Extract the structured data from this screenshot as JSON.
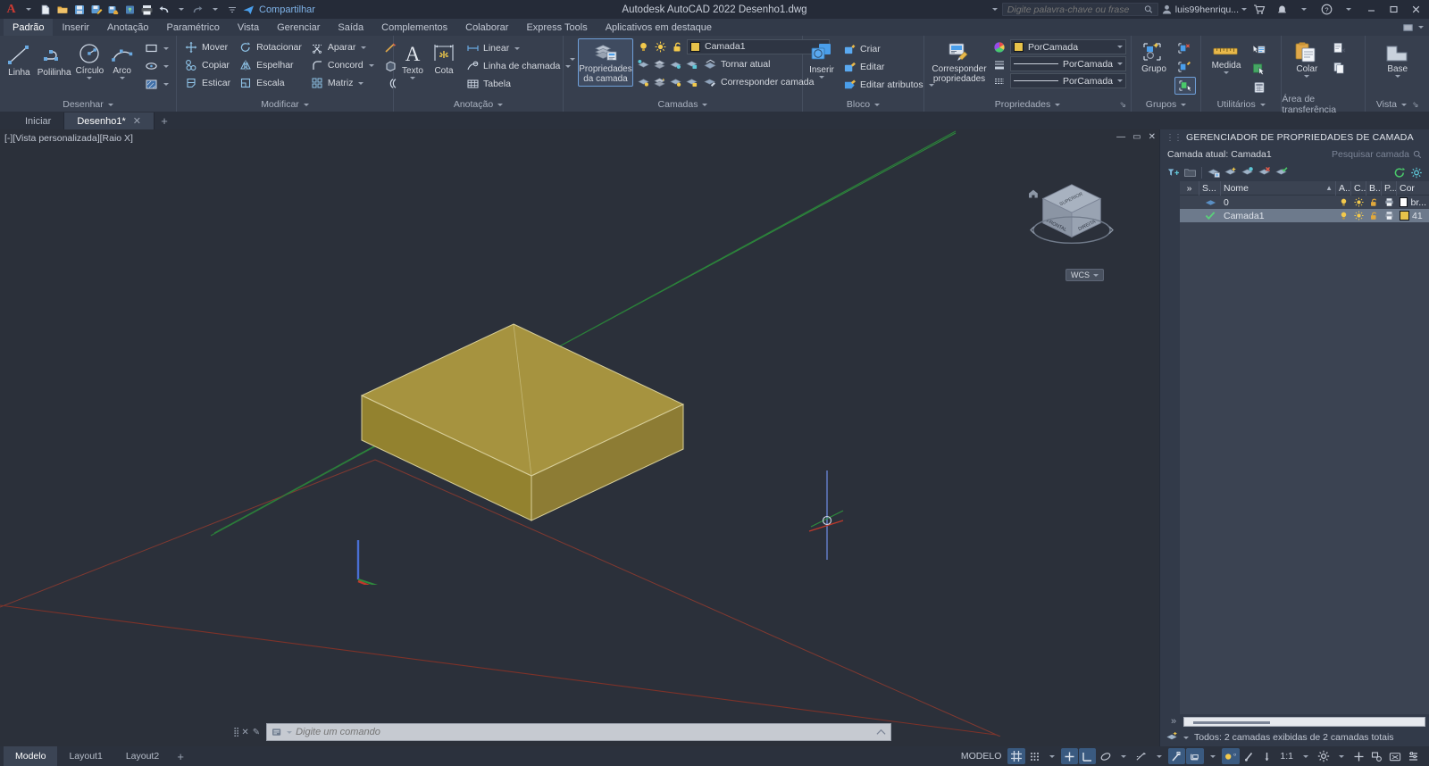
{
  "titlebar": {
    "app_logo": "autocad-a-logo",
    "quick_access": [
      {
        "name": "new-icon",
        "label": "Novo"
      },
      {
        "name": "open-icon",
        "label": "Abrir"
      },
      {
        "name": "save-icon",
        "label": "Salvar"
      },
      {
        "name": "save-as-icon",
        "label": "Salvar como"
      },
      {
        "name": "save-cloud-icon",
        "label": "Salvar no Web e Mobile"
      },
      {
        "name": "open-cloud-icon",
        "label": "Abrir do Web e Mobile"
      },
      {
        "name": "plot-icon",
        "label": "Plotar"
      },
      {
        "name": "undo-icon",
        "label": "Desfazer"
      },
      {
        "name": "redo-icon",
        "label": "Refazer"
      }
    ],
    "share_label": "Compartilhar",
    "title": "Autodesk AutoCAD 2022    Desenho1.dwg",
    "search_placeholder": "Digite palavra-chave ou frase",
    "user": "luis99henriqu...",
    "window_buttons": [
      "minimize",
      "maximize",
      "close"
    ]
  },
  "ribbon_tabs": [
    {
      "label": "Padrão",
      "active": true
    },
    {
      "label": "Inserir",
      "active": false
    },
    {
      "label": "Anotação",
      "active": false
    },
    {
      "label": "Paramétrico",
      "active": false
    },
    {
      "label": "Vista",
      "active": false
    },
    {
      "label": "Gerenciar",
      "active": false
    },
    {
      "label": "Saída",
      "active": false
    },
    {
      "label": "Complementos",
      "active": false
    },
    {
      "label": "Colaborar",
      "active": false
    },
    {
      "label": "Express Tools",
      "active": false
    },
    {
      "label": "Aplicativos em destaque",
      "active": false
    }
  ],
  "panels": {
    "desenhar": {
      "title": "Desenhar",
      "big": [
        {
          "label": "Linha",
          "icon": "line-icon"
        },
        {
          "label": "Polilinha",
          "icon": "polyline-icon"
        },
        {
          "label": "Círculo",
          "icon": "circle-icon",
          "dropdown": true
        },
        {
          "label": "Arco",
          "icon": "arc-icon",
          "dropdown": true
        }
      ],
      "small_icons": [
        {
          "name": "rectangle-icon"
        },
        {
          "name": "ellipse-icon"
        },
        {
          "name": "hatch-icon"
        }
      ]
    },
    "modificar": {
      "title": "Modificar",
      "items": [
        {
          "label": "Mover",
          "icon": "move-icon"
        },
        {
          "label": "Rotacionar",
          "icon": "rotate-icon"
        },
        {
          "label": "Aparar",
          "icon": "trim-icon",
          "dropdown": true
        },
        {
          "label": "Copiar",
          "icon": "copy-icon"
        },
        {
          "label": "Espelhar",
          "icon": "mirror-icon"
        },
        {
          "label": "Concord",
          "icon": "fillet-icon",
          "dropdown": true
        },
        {
          "label": "Esticar",
          "icon": "stretch-icon"
        },
        {
          "label": "Escala",
          "icon": "scale-icon"
        },
        {
          "label": "Matriz",
          "icon": "array-icon",
          "dropdown": true
        }
      ],
      "extra_icons": [
        {
          "name": "explode-icon"
        },
        {
          "name": "solid-edit-icon"
        },
        {
          "name": "offset-icon"
        }
      ]
    },
    "anotacao": {
      "title": "Anotação",
      "big": [
        {
          "label": "Texto",
          "icon": "text-icon",
          "dropdown": true
        },
        {
          "label": "Cota",
          "icon": "dimension-icon"
        }
      ],
      "items": [
        {
          "label": "Linear",
          "icon": "linear-dim-icon",
          "dropdown": true
        },
        {
          "label": "Linha de chamada",
          "icon": "leader-icon",
          "dropdown": true
        },
        {
          "label": "Tabela",
          "icon": "table-icon"
        }
      ]
    },
    "camadas": {
      "title": "Camadas",
      "big": {
        "label_line1": "Propriedades",
        "label_line2": "da camada",
        "icon": "layer-properties-icon",
        "active": true
      },
      "current_layer": "Camada1",
      "layer_color": "#e8c34a",
      "toolbar_icons": [
        "lightbulb-icon",
        "sun-icon",
        "unlock-icon"
      ],
      "items": [
        {
          "label": "Tornar atual",
          "icon": "make-current-icon"
        },
        {
          "label": "Corresponder camada",
          "icon": "match-layer-icon"
        }
      ],
      "row_icons_top": [
        "layer-isolate-icon",
        "layer-freeze-icon",
        "layer-off-icon",
        "layer-lock-icon"
      ],
      "row_icons_bottom": [
        "layer-unisolate-icon",
        "layer-thaw-icon",
        "layer-on-icon",
        "layer-unlock-icon"
      ]
    },
    "bloco": {
      "title": "Bloco",
      "big": {
        "label": "Inserir",
        "icon": "insert-block-icon",
        "dropdown": true
      },
      "items": [
        {
          "label": "Criar",
          "icon": "create-block-icon"
        },
        {
          "label": "Editar",
          "icon": "edit-block-icon"
        },
        {
          "label": "Editar atributos",
          "icon": "edit-attributes-icon",
          "dropdown": true
        }
      ]
    },
    "propriedades": {
      "title": "Propriedades",
      "big": {
        "label_line1": "Corresponder",
        "label_line2": "propriedades",
        "icon": "match-properties-icon"
      },
      "rows": [
        {
          "icon": "color-wheel-icon",
          "value": "PorCamada",
          "swatch": "#e8c34a",
          "type": "color"
        },
        {
          "icon": "lineweight-icon",
          "value": "PorCamada",
          "type": "lineweight"
        },
        {
          "icon": "linetype-icon",
          "value": "PorCamada",
          "type": "linetype"
        }
      ]
    },
    "grupos": {
      "title": "Grupos",
      "big": {
        "label": "Grupo",
        "icon": "group-icon"
      },
      "small_icons": [
        "ungroup-icon",
        "group-edit-icon",
        "group-select-icon"
      ]
    },
    "utilitarios": {
      "title": "Utilitários",
      "big": {
        "label": "Medida",
        "icon": "measure-icon",
        "dropdown": true
      },
      "small_icons": [
        "quick-select-icon",
        "quick-calc-area-icon",
        "calculator-icon"
      ]
    },
    "area_transferencia": {
      "title": "Área de transferência",
      "big": {
        "label": "Colar",
        "icon": "paste-icon",
        "dropdown": true
      },
      "small_icons": [
        "cut-icon",
        "copy-clip-icon"
      ]
    },
    "vista": {
      "title": "Vista",
      "big": {
        "label": "Base",
        "icon": "base-view-icon",
        "dropdown": true
      }
    }
  },
  "file_tabs": [
    {
      "label": "Iniciar",
      "active": false,
      "closable": false
    },
    {
      "label": "Desenho1*",
      "active": true,
      "closable": true
    }
  ],
  "canvas": {
    "viewport_label": "[-][Vista personalizada][Raio X]",
    "viewcube_faces": [
      "FRONTAL",
      "DIREITA",
      "SUPERIOR"
    ],
    "wcs_label": "WCS",
    "solid_color": "#a6933f",
    "solid_top_color": "#b5a14a",
    "solid_side_color": "#8d7c34",
    "axis_x_color": "#c0392b",
    "axis_y_color": "#2e8b3d",
    "axis_z_color": "#4a6fd4"
  },
  "layer_manager": {
    "title": "GERENCIADOR DE PROPRIEDADES DE CAMADA",
    "current_layer_label": "Camada atual: Camada1",
    "search_placeholder": "Pesquisar camada",
    "columns": [
      "S...",
      "Nome",
      "A...",
      "C...",
      "B...",
      "P...",
      "Cor"
    ],
    "rows": [
      {
        "status": "layer-icon",
        "name": "0",
        "on": "lightbulb-icon",
        "freeze": "sun-icon",
        "lock": "unlock-icon",
        "plot": "printer-icon",
        "color_swatch": "#ffffff",
        "color": "br..."
      },
      {
        "status": "check-icon",
        "name": "Camada1",
        "on": "lightbulb-icon",
        "freeze": "sun-icon",
        "lock": "unlock-icon",
        "plot": "printer-icon",
        "color_swatch": "#e8c34a",
        "color": "41",
        "selected": true
      }
    ],
    "status_text": "Todos: 2 camadas exibidas de 2 camadas totais",
    "toolbar_icons": [
      "new-property-filter-icon",
      "new-group-filter-icon",
      "layer-states-icon",
      "new-layer-icon",
      "new-layer-frozen-icon",
      "delete-layer-icon",
      "set-current-icon"
    ],
    "right_icons": [
      "refresh-icon",
      "settings-icon"
    ]
  },
  "command_line": {
    "placeholder": "Digite um comando",
    "handle_icons": [
      "grip-icon",
      "close-icon",
      "customize-icon"
    ],
    "prompt_icon": "command-history-icon"
  },
  "bottom_bar": {
    "model_tabs": [
      {
        "label": "Modelo",
        "active": true
      },
      {
        "label": "Layout1",
        "active": false
      },
      {
        "label": "Layout2",
        "active": false
      }
    ],
    "space_label": "MODELO",
    "scale": "1:1",
    "status_items": [
      {
        "name": "grid-display-icon",
        "on": true
      },
      {
        "name": "snap-mode-icon",
        "on": false,
        "dropdown": true
      },
      {
        "name": "ortho-mode-icon",
        "on": false
      },
      {
        "name": "polar-tracking-icon",
        "on": true
      },
      {
        "name": "isometric-draft-icon",
        "on": false,
        "dropdown": true
      },
      {
        "name": "object-snap-tracking-icon",
        "on": false,
        "dropdown": true
      },
      {
        "name": "object-snap-icon",
        "on": true
      },
      {
        "name": "ucs-icon",
        "on": true,
        "dropdown": true
      },
      {
        "name": "lineweight-display-icon",
        "on": true
      },
      {
        "name": "transparency-icon",
        "on": false
      },
      {
        "name": "selection-cycling-icon",
        "on": false
      },
      {
        "name": "annotation-scale-icon",
        "on": false,
        "dropdown": true
      },
      {
        "name": "workspace-gear-icon",
        "on": false,
        "dropdown": true
      },
      {
        "name": "hardware-accel-icon",
        "on": false
      },
      {
        "name": "isolate-objects-icon",
        "on": false
      },
      {
        "name": "screen-capture-icon",
        "on": false
      },
      {
        "name": "customization-icon",
        "on": false
      }
    ]
  }
}
